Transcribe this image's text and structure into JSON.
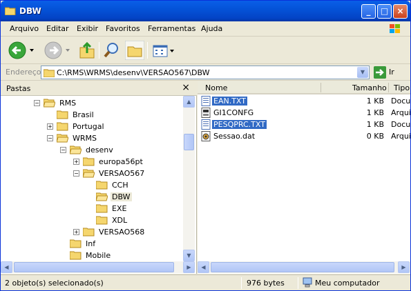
{
  "window": {
    "title": "DBW"
  },
  "menu": [
    "Arquivo",
    "Editar",
    "Exibir",
    "Favoritos",
    "Ferramentas",
    "Ajuda"
  ],
  "address": {
    "label": "Endereço",
    "path": "C:\\RMS\\WRMS\\desenv\\VERSAO567\\DBW",
    "go_label": "Ir"
  },
  "folders_pane": {
    "title": "Pastas",
    "close": "×"
  },
  "tree": [
    {
      "label": "RMS",
      "expander": "−"
    },
    {
      "label": "Brasil"
    },
    {
      "label": "Portugal",
      "expander": "+"
    },
    {
      "label": "WRMS",
      "expander": "−"
    },
    {
      "label": "desenv",
      "expander": "−"
    },
    {
      "label": "europa56pt",
      "expander": "+"
    },
    {
      "label": "VERSAO567",
      "expander": "−"
    },
    {
      "label": "CCH"
    },
    {
      "label": "DBW"
    },
    {
      "label": "EXE"
    },
    {
      "label": "XDL"
    },
    {
      "label": "VERSAO568",
      "expander": "+"
    },
    {
      "label": "Inf"
    },
    {
      "label": "Mobile"
    }
  ],
  "columns": {
    "name": "Nome",
    "size": "Tamanho",
    "type": "Tipo"
  },
  "files": [
    {
      "name": "EAN.TXT",
      "size": "1 KB",
      "type": "Docu",
      "icon": "text-file-icon",
      "selected": true
    },
    {
      "name": "GI1CONFG",
      "size": "1 KB",
      "type": "Arqui",
      "icon": "config-file-icon",
      "selected": false
    },
    {
      "name": "PESQPRC.TXT",
      "size": "1 KB",
      "type": "Docu",
      "icon": "text-file-icon",
      "selected": true
    },
    {
      "name": "Sessao.dat",
      "size": "0 KB",
      "type": "Arqui",
      "icon": "dat-file-icon",
      "selected": false
    }
  ],
  "status": {
    "selection": "2 objeto(s) selecionado(s)",
    "size": "976 bytes",
    "location": "Meu computador"
  }
}
